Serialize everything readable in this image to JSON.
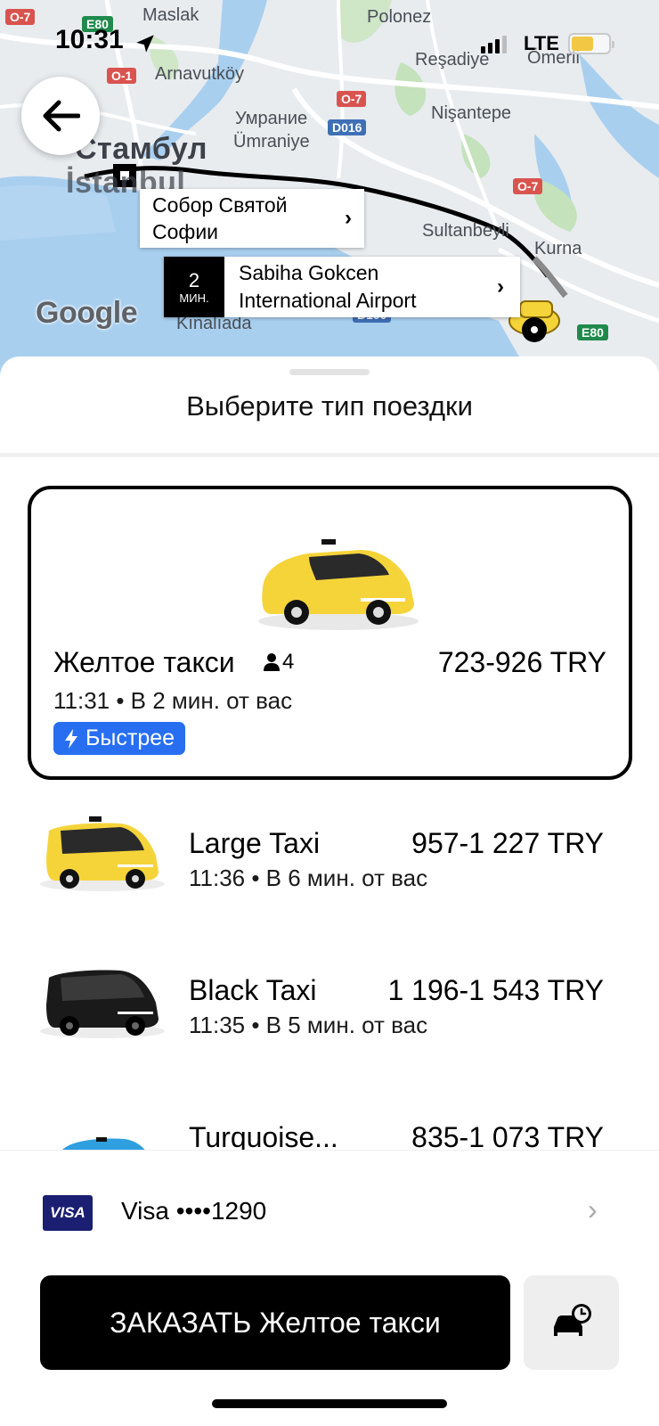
{
  "status_bar": {
    "time": "10:31",
    "network": "LTE"
  },
  "map": {
    "labels": {
      "maslak": "Maslak",
      "polonez": "Polonez",
      "resadiye": "Reşadiye",
      "omerli": "Ömerli",
      "arnavutkoy": "Arnavutköy",
      "umranie_ru": "Умрание",
      "umraniye": "Ümraniye",
      "nisantepe": "Nişantepe",
      "istanbul_ru": "Стамбул",
      "istanbul": "İstanbul",
      "sultanbeyli": "Sultanbeyli",
      "kurna": "Kurna",
      "kinaliada": "Kınalıada"
    },
    "shields": {
      "o7_a": "O-7",
      "e80_a": "E80",
      "o1": "O-1",
      "o7_b": "O-7",
      "d016": "D016",
      "o7_c": "O-7",
      "d100": "D100",
      "e80_b": "E80"
    },
    "origin_callout": "Собор Святой Софии",
    "destination_callout": {
      "eta_number": "2",
      "eta_unit": "МИН.",
      "name": "Sabiha Gokcen International Airport"
    },
    "provider_logo": "Google"
  },
  "sheet": {
    "title": "Выберите тип поездки",
    "options": [
      {
        "name": "Желтое такси",
        "seats": "4",
        "price": "723-926 TRY",
        "eta": "11:31 • В 2 мин. от вас",
        "badge": "Быстрее",
        "car_color": "#f5d43a"
      },
      {
        "name": "Large Taxi",
        "price": "957-1 227 TRY",
        "eta": "11:36 • В 6 мин. от вас",
        "car_color": "#f5d43a"
      },
      {
        "name": "Black Taxi",
        "price": "1 196-1 543 TRY",
        "eta": "11:35 • В 5 мин. от вас",
        "car_color": "#1a1a1a"
      },
      {
        "name": "Turquoise...",
        "price": "835-1 073 TRY",
        "car_color": "#2f9fe0"
      }
    ]
  },
  "payment": {
    "card_brand": "VISA",
    "label": "Visa ••••1290"
  },
  "order_button": "ЗАКАЗАТЬ Желтое такси",
  "colors": {
    "accent_blue": "#276ef1",
    "taxi_yellow": "#f5d43a",
    "battery_yellow": "#f2c744"
  }
}
